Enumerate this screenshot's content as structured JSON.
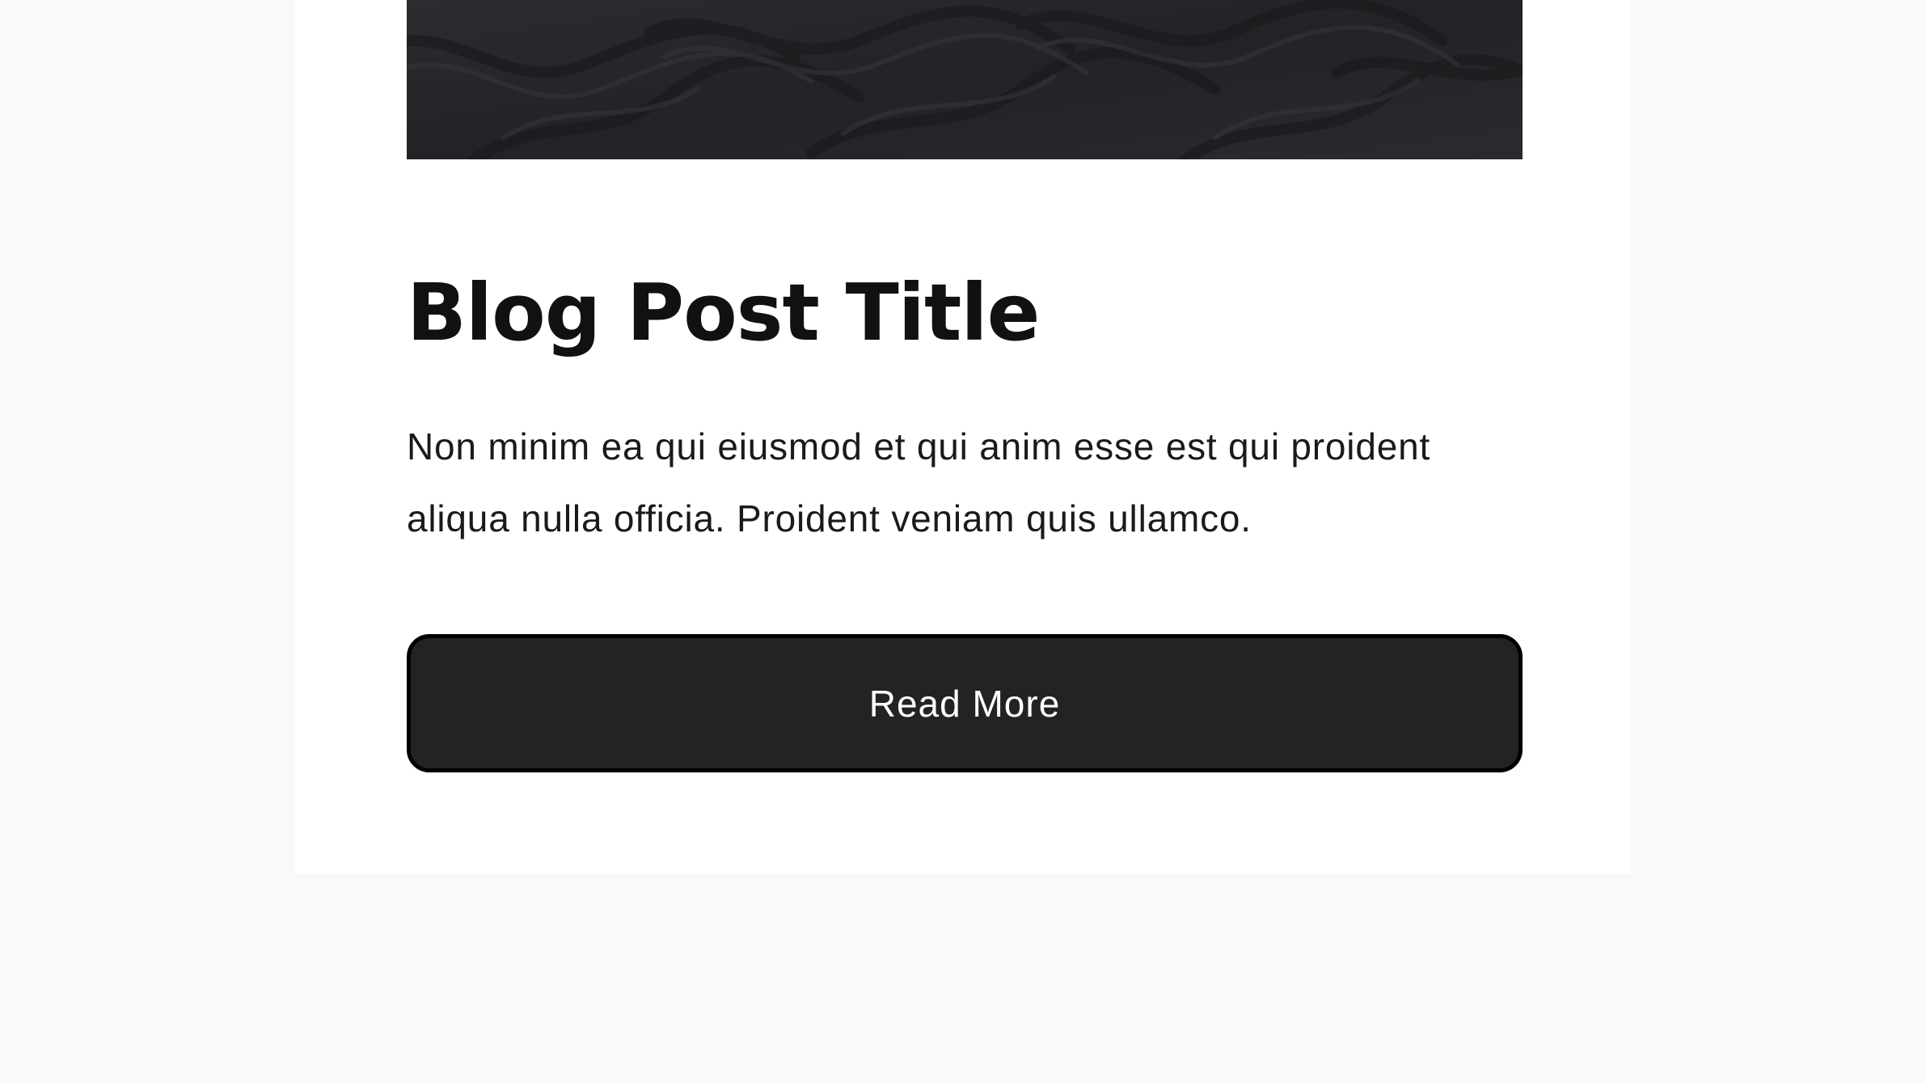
{
  "post": {
    "image": {
      "icon": "dark-sand-dunes-image",
      "color": "#26272a"
    },
    "title": "Blog Post Title",
    "excerpt": "Non minim ea qui eiusmod et qui anim esse est qui proident aliqua nulla officia. Proident veniam quis ullamco.",
    "button_label": "Read More"
  },
  "colors": {
    "page_background": "#f9f9f9",
    "card_background": "#ffffff",
    "button_background": "#232323",
    "button_text": "#ffffff",
    "text": "#111111"
  }
}
